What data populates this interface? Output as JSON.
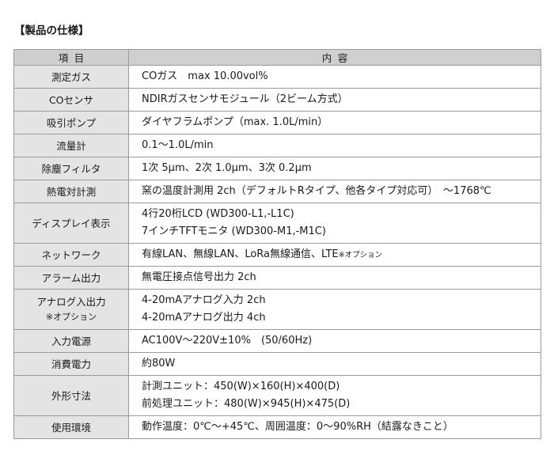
{
  "heading": "【製品の仕様】",
  "table": {
    "header": {
      "item": "項目",
      "content": "内容"
    },
    "rows": [
      {
        "label": "測定ガス",
        "lines": [
          "COガス　max 10.00vol%"
        ]
      },
      {
        "label": "COセンサ",
        "lines": [
          "NDIRガスセンサモジュール（2ビーム方式）"
        ]
      },
      {
        "label": "吸引ポンプ",
        "lines": [
          "ダイヤフラムポンプ（max. 1.0L/min）"
        ]
      },
      {
        "label": "流量計",
        "lines": [
          "0.1〜1.0L/min"
        ]
      },
      {
        "label": "除塵フィルタ",
        "lines": [
          "1次 5μm、2次 1.0μm、3次 0.2μm"
        ]
      },
      {
        "label": "熱電対計測",
        "lines": [
          "窯の温度計測用 2ch（デフォルトRタイプ、他各タイプ対応可）　〜1768℃"
        ]
      },
      {
        "label": "ディスプレイ表示",
        "lines": [
          "4行20桁LCD (WD300-L1,-L1C)",
          "7インチTFTモニタ (WD300-M1,-M1C)"
        ]
      },
      {
        "label": "ネットワーク",
        "text": "有線LAN、無線LAN、LoRa無線通信、LTE",
        "note": "※オプション"
      },
      {
        "label": "アラーム出力",
        "lines": [
          "無電圧接点信号出力 2ch"
        ]
      },
      {
        "label": "アナログ入出力",
        "sublabel": "※オプション",
        "lines": [
          "4-20mAアナログ入力 2ch",
          "4-20mAアナログ出力 4ch"
        ]
      },
      {
        "label": "入力電源",
        "lines": [
          "AC100V〜220V±10%　(50/60Hz)"
        ]
      },
      {
        "label": "消費電力",
        "lines": [
          "約80W"
        ]
      },
      {
        "label": "外形寸法",
        "lines": [
          "計測ユニット：450(W)×160(H)×400(D)",
          "前処理ユニット：480(W)×945(H)×475(D)"
        ]
      },
      {
        "label": "使用環境",
        "lines": [
          "動作温度：0℃〜+45℃、周囲温度：0〜90%RH（結露なきこと）"
        ]
      }
    ]
  }
}
